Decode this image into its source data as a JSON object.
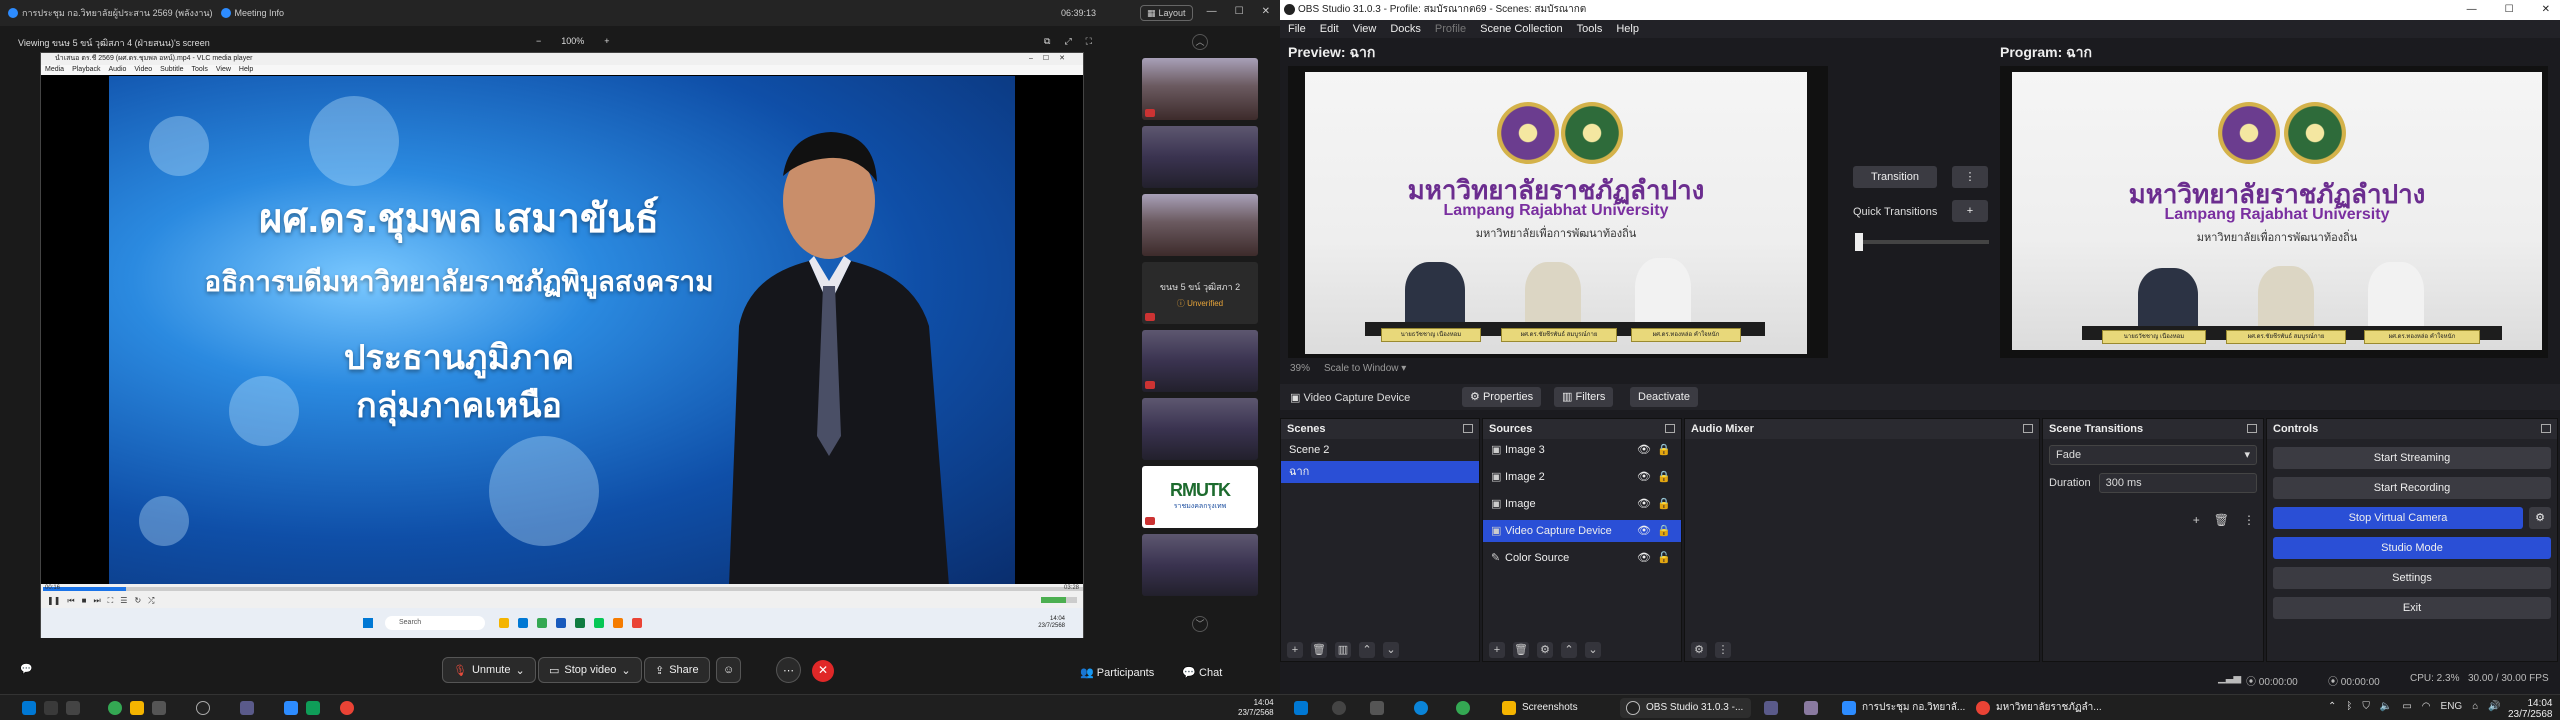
{
  "zoom": {
    "titlebar": {
      "meeting_title": "การประชุม กอ.วิทยาลัยผู้ประสาน 2569 (พลังงาน)",
      "meeting_info": "Meeting Info",
      "clock": "06:39:13",
      "layout": "Layout"
    },
    "viewing": {
      "label": "Viewing ขนษ 5 ขน์ วุฒิสภา 4 (ฝ่ายสนน)'s screen",
      "zoom_minus": "−",
      "zoom_level": "100%",
      "zoom_plus": "+"
    },
    "vlc": {
      "title": "นำเสนอ ตร.ชี 2569 (ผศ.ดร.ชุมพล อหน์).mp4 - VLC media player",
      "menu": [
        "Media",
        "Playback",
        "Audio",
        "Video",
        "Subtitle",
        "Tools",
        "View",
        "Help"
      ],
      "time_elapsed": "00:16",
      "time_total": "03:28",
      "progress": 0.08,
      "search_placeholder": "Search",
      "clock": "14:04",
      "date": "23/7/2568"
    },
    "slide": {
      "name": "ผศ.ดร.ชุมพล เสมาขันธ์",
      "role": "อธิการบดีมหาวิทยาลัยราชภัฏพิบูลสงคราม",
      "title_line1": "ประธานภูมิภาค",
      "title_line2": "กลุ่มภาคเหนือ"
    },
    "gallery": {
      "participant_name": "ขนษ 5 ขน์ วุฒิสภา 2",
      "participant_status": "Unverified",
      "logo_text": "RMUTK",
      "logo_sub": "ราชมงคลกรุงเทพ"
    },
    "toolbar": {
      "unmute": "Unmute",
      "stop_video": "Stop video",
      "share": "Share",
      "participants": "Participants",
      "chat": "Chat"
    }
  },
  "obs": {
    "title": "OBS Studio 31.0.3 - Profile: สมบัรณากต69 - Scenes: สมบัรณากต",
    "menu": [
      "File",
      "Edit",
      "View",
      "Docks",
      "Profile",
      "Scene Collection",
      "Tools",
      "Help"
    ],
    "preview_label": "Preview: ฉาก",
    "program_label": "Program: ฉาก",
    "transition": "Transition",
    "quick_transitions": "Quick Transitions",
    "canvas_zoom": "39%",
    "scale_mode": "Scale to Window",
    "scene_content": {
      "thai_title": "มหาวิทยาลัยราชภัฏลำปาง",
      "eng_title": "Lampang Rajabhat University",
      "tagline": "มหาวิทยาลัยเพื่อการพัฒนาท้องถิ่น",
      "plates": [
        "นายธวัชชาญ เนืองหอม",
        "ผศ.ดร.ชัยชีรพันธ์ สมบูรณ์กาย",
        "ผศ.ดร.ทองหล่อ คำใจหนัก"
      ]
    },
    "source_bar": {
      "current": "Video Capture Device",
      "properties": "Properties",
      "filters": "Filters",
      "deactivate": "Deactivate"
    },
    "docks": {
      "scenes": {
        "title": "Scenes",
        "items": [
          "Scene 2",
          "ฉาก"
        ]
      },
      "sources": {
        "title": "Sources",
        "items": [
          "Image 3",
          "Image 2",
          "Image",
          "Video Capture Device",
          "Color Source"
        ]
      },
      "audio_mixer": {
        "title": "Audio Mixer"
      },
      "scene_transitions": {
        "title": "Scene Transitions",
        "type": "Fade",
        "duration_label": "Duration",
        "duration_value": "300 ms"
      },
      "controls": {
        "title": "Controls",
        "buttons": [
          "Start Streaming",
          "Start Recording",
          "Stop Virtual Camera",
          "Studio Mode",
          "Settings",
          "Exit"
        ]
      }
    },
    "status": {
      "stream_time": "00:00:00",
      "rec_time": "00:00:00",
      "cpu": "CPU: 2.3%",
      "fps": "30.00 / 30.00 FPS"
    }
  },
  "taskbar": {
    "apps": [
      "Screenshots",
      "OBS Studio 31.0.3 -...",
      "การประชุม กอ.วิทยาลั...",
      "มหาวิทยาลัยราชภัฏลำ..."
    ],
    "lang": "ENG",
    "clock_left": "14:04",
    "date_left": "23/7/2568",
    "clock": "14:04",
    "date": "23/7/2568"
  }
}
